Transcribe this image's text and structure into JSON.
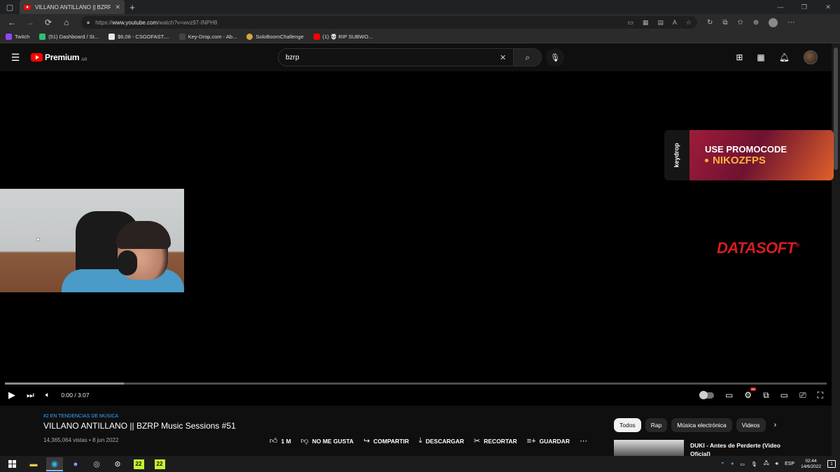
{
  "browser": {
    "tab_title": "VILLANO ANTILLANO || BZRP M...",
    "url_prefix": "https://",
    "url_domain": "www.youtube.com",
    "url_path": "/watch?v=wvz97-INPH8",
    "bookmarks": [
      {
        "label": "Twitch",
        "color": "#9146ff"
      },
      {
        "label": "(51) Dashboard / St...",
        "color": "#2fbf71"
      },
      {
        "label": "$6,08 - CSGOFAST....",
        "color": "#e8e8e8"
      },
      {
        "label": "Key-Drop.com - Ab...",
        "color": "#444444"
      },
      {
        "label": "SoloBoomChallenge",
        "color": "#d9a441"
      },
      {
        "label": "(1) 💀 RIP SUBWO...",
        "color": "#ff0000"
      }
    ]
  },
  "youtube": {
    "logo_text": "Premium",
    "logo_country": "AR",
    "search_value": "bzrp",
    "video": {
      "time": "0:00 / 3:07",
      "progress_fraction": 0,
      "loaded_fraction": 0.145,
      "quality_badge": "HD",
      "trending": "#2 EN TENDENCIAS DE MÚSICA",
      "title": "VILLANO ANTILLANO || BZRP Music Sessions #51",
      "meta": "14,365,064 vistas • 8 jun 2022",
      "actions": {
        "like": "1 M",
        "dislike": "NO ME GUSTA",
        "share": "COMPARTIR",
        "download": "DESCARGAR",
        "clip": "RECORTAR",
        "save": "GUARDAR"
      }
    },
    "overlay": {
      "keydrop_brand": "keydrop",
      "keydrop_line1": "USE PROMOCODE",
      "keydrop_line2": "NIKOZFPS",
      "datasoft": "DATASOFT",
      "datasoft_mark": "®"
    },
    "chips": [
      "Todos",
      "Rap",
      "Música electrónica",
      "Videos"
    ],
    "recommended": {
      "title": "DUKI - Antes de Perderte (Video Oficial)"
    }
  },
  "taskbar": {
    "app_badge_1": "22",
    "app_badge_2": "22",
    "lang": "ESP",
    "time": "02:44",
    "date": "14/6/2022",
    "notif_count": "1"
  }
}
